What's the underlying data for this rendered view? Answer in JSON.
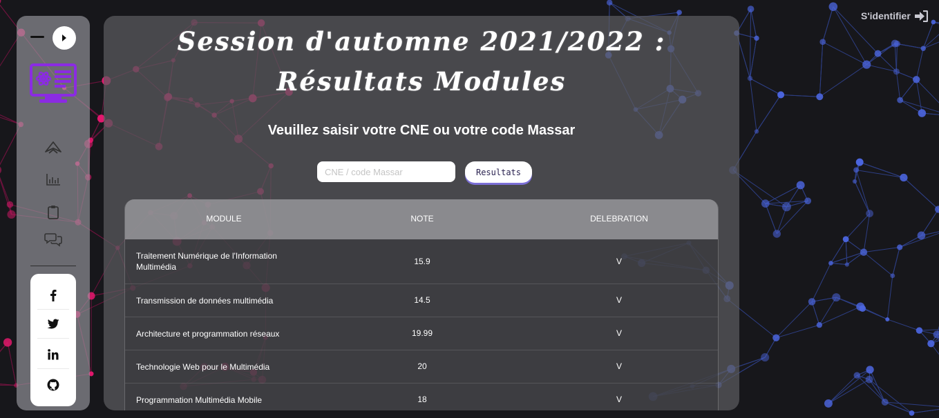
{
  "header": {
    "title": "Session d'automne 2021/2022 : Résultats Modules",
    "login_label": "S'identifier"
  },
  "search": {
    "prompt": "Veuillez saisir votre CNE ou votre code Massar",
    "placeholder": "CNE / code Massar",
    "button_label": "Resultats"
  },
  "sidebar": {
    "nav_icons": [
      "paper-plane-icon",
      "bar-chart-icon",
      "clipboard-icon",
      "chat-bubbles-icon"
    ],
    "social_icons": [
      "facebook-icon",
      "twitter-icon",
      "linkedin-icon",
      "github-icon"
    ]
  },
  "table": {
    "headers": [
      "MODULE",
      "NOTE",
      "DELEBRATION"
    ],
    "rows": [
      {
        "module": "Traitement Numérique de l'Information Multimédia",
        "note": "15.9",
        "deliberation": "V"
      },
      {
        "module": "Transmission de données multimédia",
        "note": "14.5",
        "deliberation": "V"
      },
      {
        "module": "Architecture et programmation réseaux",
        "note": "19.99",
        "deliberation": "V"
      },
      {
        "module": "Technologie Web pour le Multimédia",
        "note": "20",
        "deliberation": "V"
      },
      {
        "module": "Programmation Multimédia Mobile",
        "note": "18",
        "deliberation": "V"
      }
    ]
  },
  "colors": {
    "accent_purple": "#8b2be2",
    "network_pink": "#e8186f",
    "network_blue": "#4a63d8",
    "button_shadow": "#7b6fd6"
  }
}
